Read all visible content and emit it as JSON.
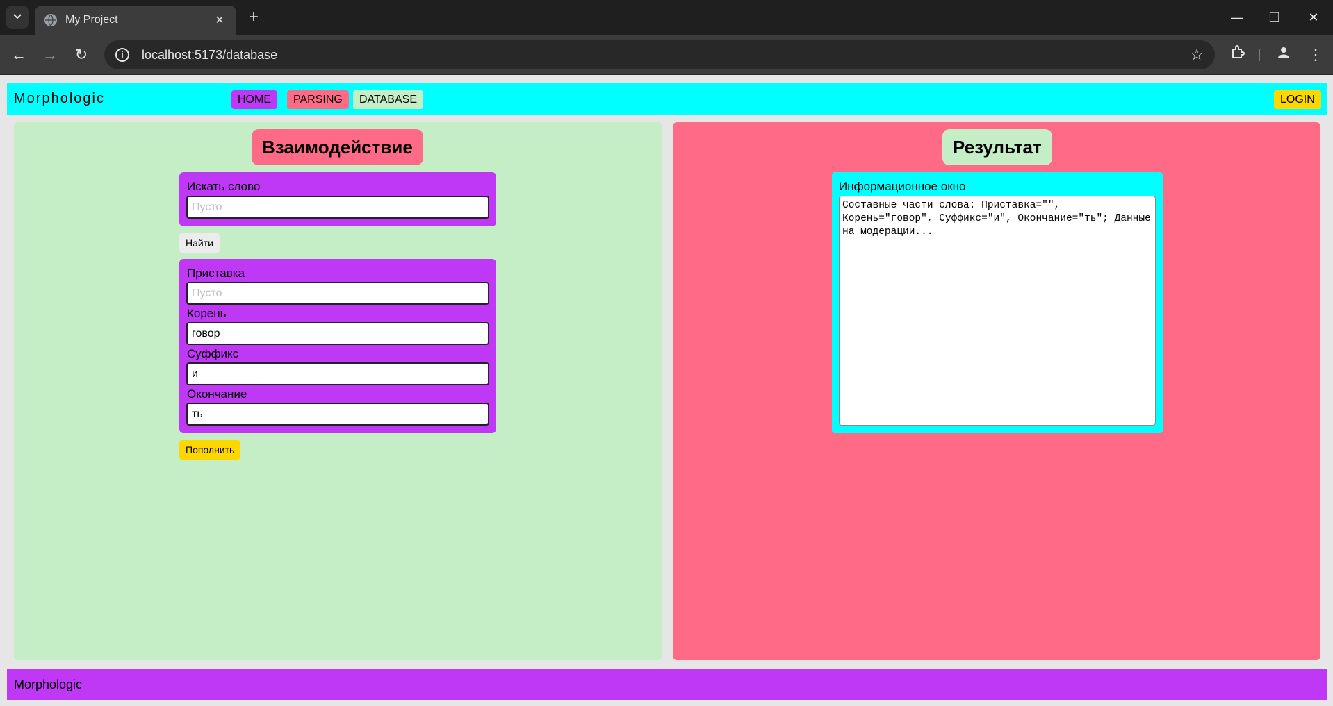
{
  "browser": {
    "tab_title": "My Project",
    "url": "localhost:5173/database"
  },
  "header": {
    "brand": "Morphologic",
    "nav": {
      "home": "HOME",
      "parsing": "PARSING",
      "database": "DATABASE"
    },
    "login": "LOGIN"
  },
  "interaction": {
    "title": "Взаимодействие",
    "search": {
      "label": "Искать слово",
      "placeholder": "Пусто",
      "value": ""
    },
    "find_button": "Найти",
    "fields": {
      "prefix": {
        "label": "Приставка",
        "placeholder": "Пусто",
        "value": ""
      },
      "root": {
        "label": "Корень",
        "value": "говор"
      },
      "suffix": {
        "label": "Суффикс",
        "value": "и"
      },
      "ending": {
        "label": "Окончание",
        "value": "ть"
      }
    },
    "fill_button": "Пополнить"
  },
  "result": {
    "title": "Результат",
    "info_label": "Информационное окно",
    "info_text": "Составные части слова: Приставка=\"\", Корень=\"говор\", Суффикс=\"и\", Окончание=\"ть\"; Данные на модерации..."
  },
  "footer": {
    "text": "Morphologic"
  },
  "colors": {
    "header_bg": "#00ffff",
    "purple": "#bf38f5",
    "pink": "#ff6b86",
    "light_green": "#c5eec7",
    "yellow": "#ffd700"
  }
}
